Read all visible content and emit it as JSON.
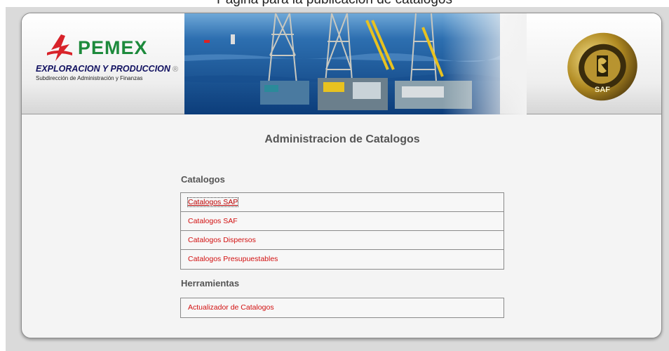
{
  "caption": "Página para la publicación de catálogos",
  "header": {
    "brand": "PEMEX",
    "division": "EXPLORACION Y PRODUCCION",
    "registered": "®",
    "subdivision": "Subdirección de Administración y Finanzas",
    "saf_badge": "SAF"
  },
  "main": {
    "title": "Administracion de Catalogos",
    "sections": [
      {
        "heading": "Catalogos",
        "links": [
          "Catalogos SAP",
          "Catalogos SAF",
          "Catalogos Dispersos",
          "Catalogos Presupuestables"
        ]
      },
      {
        "heading": "Herramientas",
        "links": [
          "Actualizador de Catalogos"
        ]
      }
    ]
  },
  "colors": {
    "link": "#d21010",
    "pemex_green": "#1d8a3c",
    "pemex_red": "#d8232a",
    "heading": "#555555"
  }
}
